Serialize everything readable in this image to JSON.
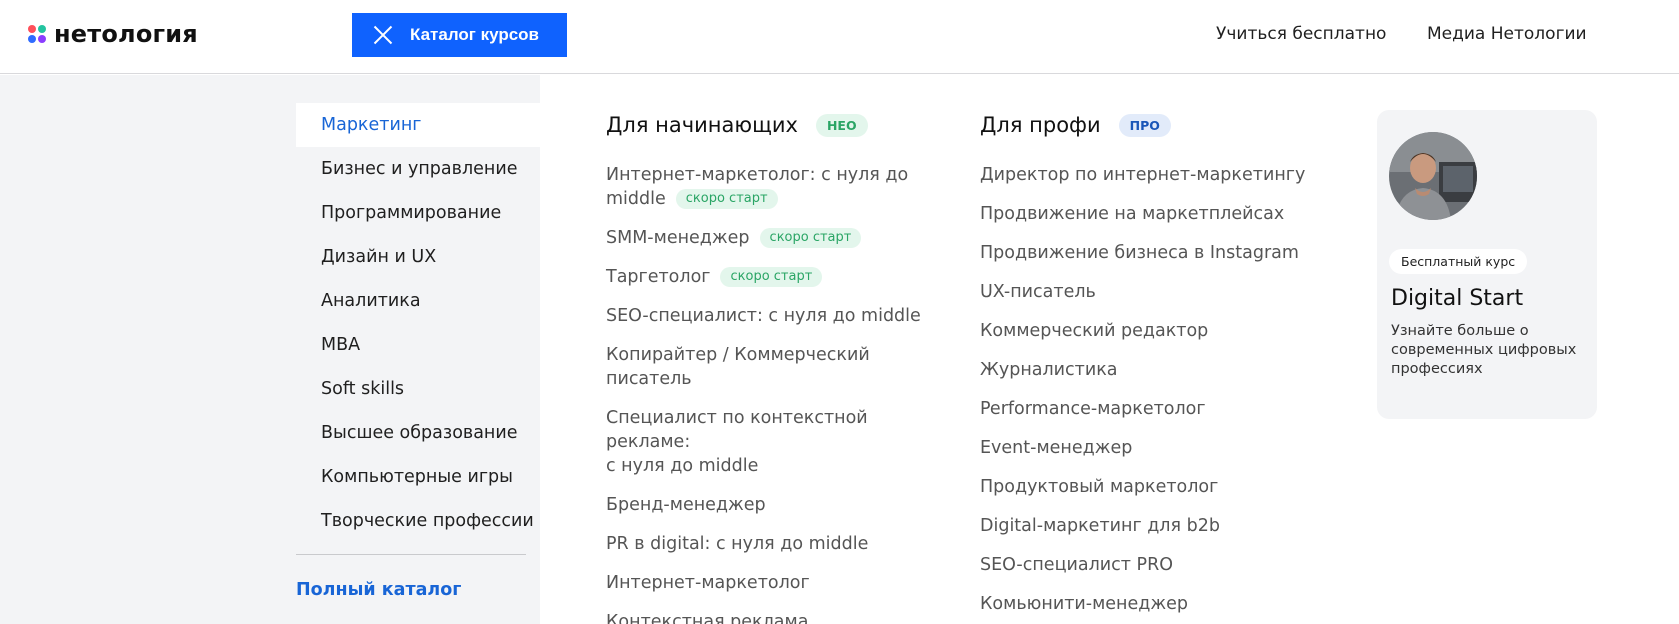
{
  "header": {
    "logo_text": "нетология",
    "catalog_button": "Каталог курсов",
    "nav": {
      "free": "Учиться бесплатно",
      "media": "Медиа Нетологии"
    }
  },
  "sidebar": {
    "items": [
      {
        "label": "Маркетинг",
        "active": true
      },
      {
        "label": "Бизнес и управление"
      },
      {
        "label": "Программирование"
      },
      {
        "label": "Дизайн и UX"
      },
      {
        "label": "Аналитика"
      },
      {
        "label": "MBA"
      },
      {
        "label": "Soft skills"
      },
      {
        "label": "Высшее образование"
      },
      {
        "label": "Компьютерные игры"
      },
      {
        "label": "Творческие профессии"
      }
    ],
    "full_catalog": "Полный каталог"
  },
  "beginners": {
    "title": "Для начинающих",
    "badge": "НЕО",
    "courses": [
      {
        "line1": "Интернет-маркетолог: с нуля до",
        "line2": "middle",
        "soon": "скоро старт"
      },
      {
        "line1": "SMM-менеджер",
        "soon": "скоро старт"
      },
      {
        "line1": "Таргетолог",
        "soon": "скоро старт"
      },
      {
        "line1": "SEO-специалист: с нуля до middle"
      },
      {
        "line1": "Копирайтер / Коммерческий",
        "line2": "писатель"
      },
      {
        "line1": "Специалист по контекстной рекламе:",
        "line2": "с нуля до middle"
      },
      {
        "line1": "Бренд-менеджер"
      },
      {
        "line1": "PR в digital: с нуля до middle"
      },
      {
        "line1": "Интернет-маркетолог"
      },
      {
        "line1": "Контекстная реклама"
      }
    ]
  },
  "pros": {
    "title": "Для профи",
    "badge": "ПРО",
    "courses": [
      "Директор по интернет-маркетингу",
      "Продвижение на маркетплейсах",
      "Продвижение бизнеса в Instagram",
      "UX-писатель",
      "Коммерческий редактор",
      "Журналистика",
      "Performance-маркетолог",
      "Event-менеджер",
      "Продуктовый маркетолог",
      "Digital-маркетинг для b2b",
      "SEO-специалист PRO",
      "Комьюнити-менеджер"
    ]
  },
  "promo": {
    "badge": "Бесплатный курс",
    "title": "Digital Start",
    "text": "Узнайте больше о современных цифровых профессиях",
    "avatar_icon": "person-photo"
  }
}
